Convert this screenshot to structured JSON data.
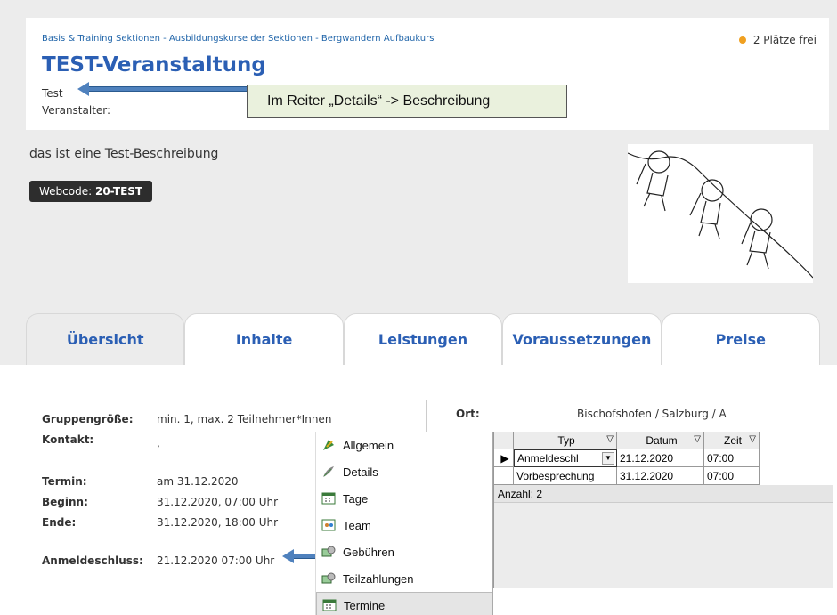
{
  "breadcrumb": "Basis & Training Sektionen - Ausbildungskurse der Sektionen - Bergwandern Aufbaukurs",
  "availability": "2 Plätze frei",
  "title": "TEST-Veranstaltung",
  "subtitle": "Test",
  "organizer_label": "Veranstalter:",
  "callout_text": "Im Reiter „Details“ -> Beschreibung",
  "description": "das ist eine Test-Beschreibung",
  "webcode_label": "Webcode:",
  "webcode_value": "20-TEST",
  "tabs": [
    {
      "label": "Übersicht"
    },
    {
      "label": "Inhalte"
    },
    {
      "label": "Leistungen"
    },
    {
      "label": "Voraussetzungen"
    },
    {
      "label": "Preise"
    }
  ],
  "fields": {
    "gruppe_label": "Gruppengröße:",
    "gruppe_value": "min. 1, max. 2 Teilnehmer*Innen",
    "kontakt_label": "Kontakt:",
    "kontakt_value": ",",
    "termin_label": "Termin:",
    "termin_value": "am 31.12.2020",
    "beginn_label": "Beginn:",
    "beginn_value": "31.12.2020, 07:00 Uhr",
    "ende_label": "Ende:",
    "ende_value": "31.12.2020, 18:00 Uhr",
    "anmelde_label": "Anmeldeschluss:",
    "anmelde_value": "21.12.2020 07:00 Uhr",
    "ort_label": "Ort:",
    "ort_value": "Bischofshofen / Salzburg / A"
  },
  "menu": [
    {
      "label": "Allgemein",
      "icon": "compass-icon"
    },
    {
      "label": "Details",
      "icon": "quill-icon"
    },
    {
      "label": "Tage",
      "icon": "calendar-icon"
    },
    {
      "label": "Team",
      "icon": "team-icon"
    },
    {
      "label": "Gebühren",
      "icon": "money-icon"
    },
    {
      "label": "Teilzahlungen",
      "icon": "money-icon"
    },
    {
      "label": "Termine",
      "icon": "calendar-icon"
    }
  ],
  "grid": {
    "columns": [
      "Typ",
      "Datum",
      "Zeit"
    ],
    "rows": [
      {
        "typ": "Anmeldeschl",
        "datum": "21.12.2020",
        "zeit": "07:00"
      },
      {
        "typ": "Vorbesprechung",
        "datum": "31.12.2020",
        "zeit": "07:00"
      }
    ],
    "footer": "Anzahl: 2"
  },
  "colors": {
    "accent": "#2b5fb4",
    "callout_bg": "#eaf1dd",
    "arrow": "#4f81bd",
    "dot": "#f0a020"
  }
}
